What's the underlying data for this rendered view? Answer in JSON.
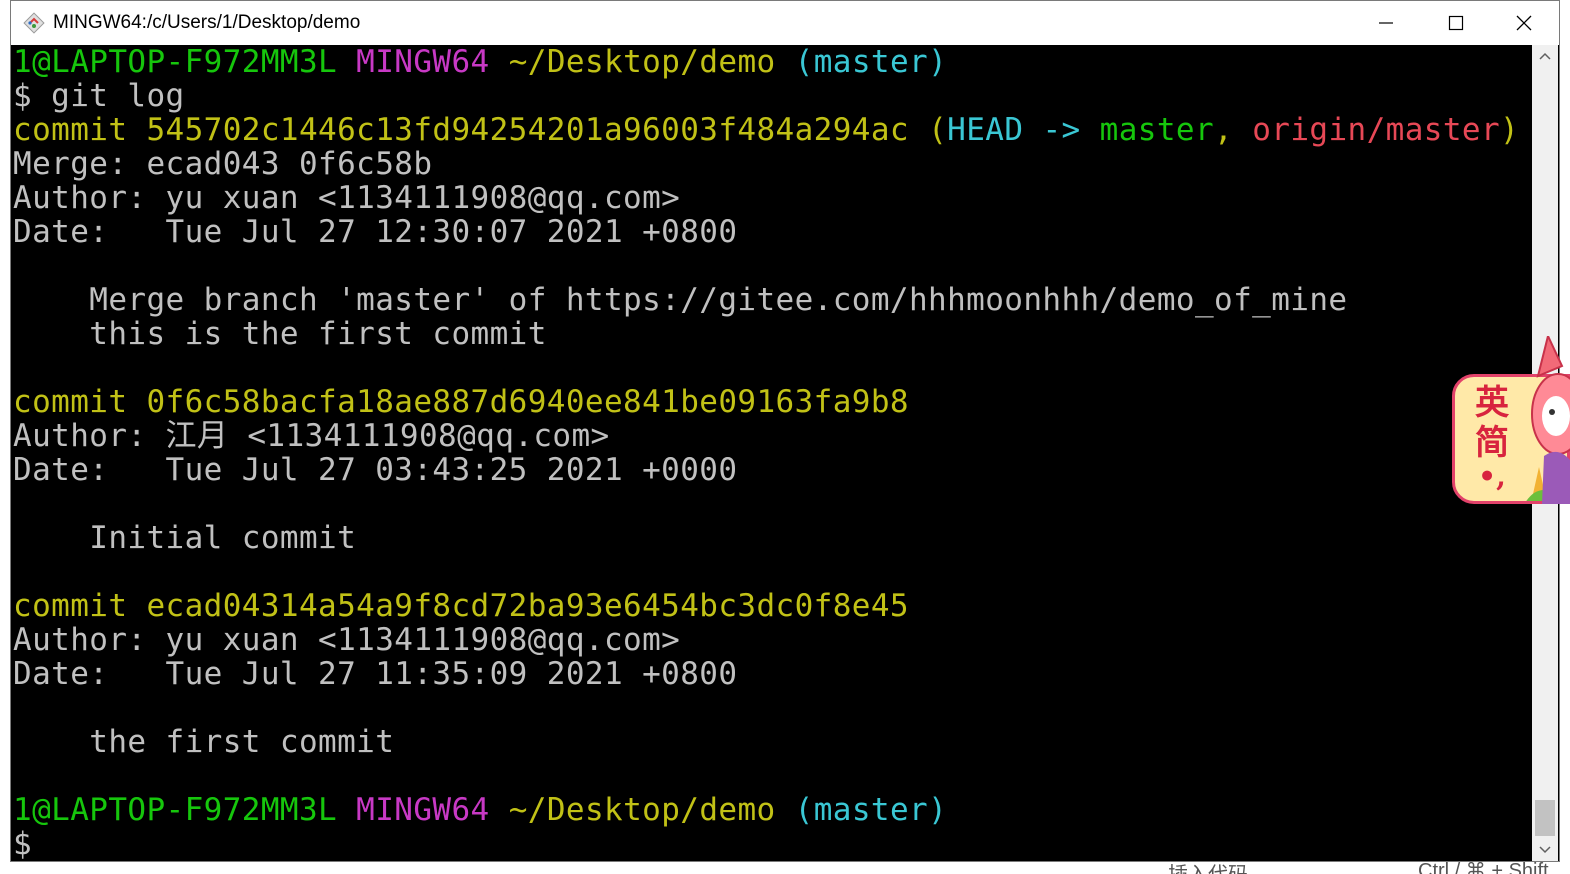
{
  "window": {
    "title": "MINGW64:/c/Users/1/Desktop/demo",
    "controls": {
      "minimize": "minimize",
      "maximize": "maximize",
      "close": "close"
    }
  },
  "terminal": {
    "prompt_user": "1@LAPTOP-F972MM3L",
    "prompt_env": "MINGW64",
    "prompt_path": "~/Desktop/demo",
    "prompt_branch": "(master)",
    "command": "$ git log",
    "commits": [
      {
        "commit_label": "commit 545702c1446c13fd94254201a96003f484a294ac",
        "ref_open": " (",
        "ref_head": "HEAD -> ",
        "ref_master": "master",
        "ref_sep": ", ",
        "ref_origin": "origin/master",
        "ref_close": ")",
        "merge": "Merge: ecad043 0f6c58b",
        "author": "Author: yu xuan <1134111908@qq.com>",
        "date": "Date:   Tue Jul 27 12:30:07 2021 +0800",
        "message_1": "    Merge branch 'master' of https://gitee.com/hhhmoonhhh/demo_of_mine",
        "message_2": "    this is the first commit"
      },
      {
        "commit_label": "commit 0f6c58bacfa18ae887d6940ee841be09163fa9b8",
        "author": "Author: 江月 <1134111908@qq.com>",
        "date": "Date:   Tue Jul 27 03:43:25 2021 +0000",
        "message_1": "    Initial commit"
      },
      {
        "commit_label": "commit ecad04314a54a9f8cd72ba93e6454bc3dc0f8e45",
        "author": "Author: yu xuan <1134111908@qq.com>",
        "date": "Date:   Tue Jul 27 11:35:09 2021 +0800",
        "message_1": "    the first commit"
      }
    ],
    "final_prompt": "$"
  },
  "ime": {
    "mode_1": "英",
    "mode_2": "简"
  },
  "background": {
    "bottom_hint": "插入代码",
    "shortcut": "Ctrl / ⌘ + Shift"
  },
  "colors": {
    "prompt_user": "#16c60c",
    "prompt_env": "#c839c5",
    "prompt_path": "#c1c116",
    "prompt_branch": "#3ac7d4",
    "commit": "#c1c116",
    "origin": "#e74856"
  },
  "icons": [
    "git-icon",
    "minimize-icon",
    "maximize-icon",
    "close-icon",
    "scroll-up-icon",
    "scroll-down-icon"
  ]
}
